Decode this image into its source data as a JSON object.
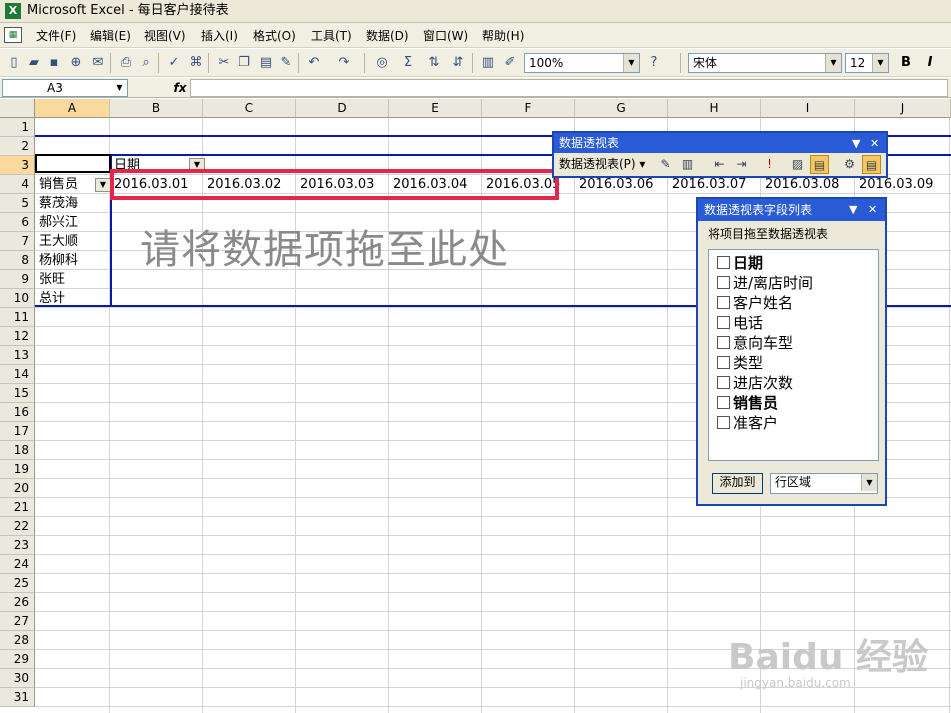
{
  "window": {
    "title": "Microsoft Excel - 每日客户接待表"
  },
  "menu": [
    "文件(F)",
    "编辑(E)",
    "视图(V)",
    "插入(I)",
    "格式(O)",
    "工具(T)",
    "数据(D)",
    "窗口(W)",
    "帮助(H)"
  ],
  "toolbar": {
    "zoom": "100%",
    "font": "宋体",
    "font_size": "12",
    "bold_label": "B",
    "italic_label": "I"
  },
  "formula_bar": {
    "name_box": "A3",
    "fx_label": "fx",
    "content": ""
  },
  "sheet": {
    "columns": [
      "A",
      "B",
      "C",
      "D",
      "E",
      "F",
      "G",
      "H",
      "I",
      "J"
    ],
    "rows": [
      "1",
      "2",
      "3",
      "4",
      "5",
      "6",
      "7",
      "8",
      "9",
      "10",
      "11",
      "12",
      "13",
      "14",
      "15",
      "16",
      "17",
      "18",
      "19",
      "20",
      "21",
      "22",
      "23",
      "24",
      "25",
      "26",
      "27",
      "28",
      "29",
      "30",
      "31"
    ],
    "selected_cell": "A3"
  },
  "pivot": {
    "column_field": "日期",
    "row_field": "销售员",
    "dates": [
      "2016.03.01",
      "2016.03.02",
      "2016.03.03",
      "2016.03.04",
      "2016.03.05",
      "2016.03.06",
      "2016.03.07",
      "2016.03.08",
      "2016.03.09"
    ],
    "row_items": [
      "蔡茂海",
      "郝兴江",
      "王大顺",
      "杨柳科",
      "张旺"
    ],
    "total_label": "总计",
    "drop_hint": "请将数据项拖至此处"
  },
  "pivot_toolbar": {
    "title": "数据透视表",
    "menu_label": "数据透视表(P)"
  },
  "field_list": {
    "title": "数据透视表字段列表",
    "instruction": "将项目拖至数据透视表",
    "fields": [
      {
        "label": "日期",
        "bold": true
      },
      {
        "label": "进/离店时间",
        "bold": false
      },
      {
        "label": "客户姓名",
        "bold": false
      },
      {
        "label": "电话",
        "bold": false
      },
      {
        "label": "意向车型",
        "bold": false
      },
      {
        "label": "类型",
        "bold": false
      },
      {
        "label": "进店次数",
        "bold": false
      },
      {
        "label": "销售员",
        "bold": true
      },
      {
        "label": "准客户",
        "bold": false
      }
    ],
    "add_button": "添加到",
    "area": "行区域"
  },
  "watermark": {
    "brand": "Baidu 经验",
    "site": "jingyan.baidu.com"
  },
  "colors": {
    "pivot_border": "#0b1a9e",
    "highlight": "#e2264d",
    "selected_header": "#f9d99e"
  }
}
